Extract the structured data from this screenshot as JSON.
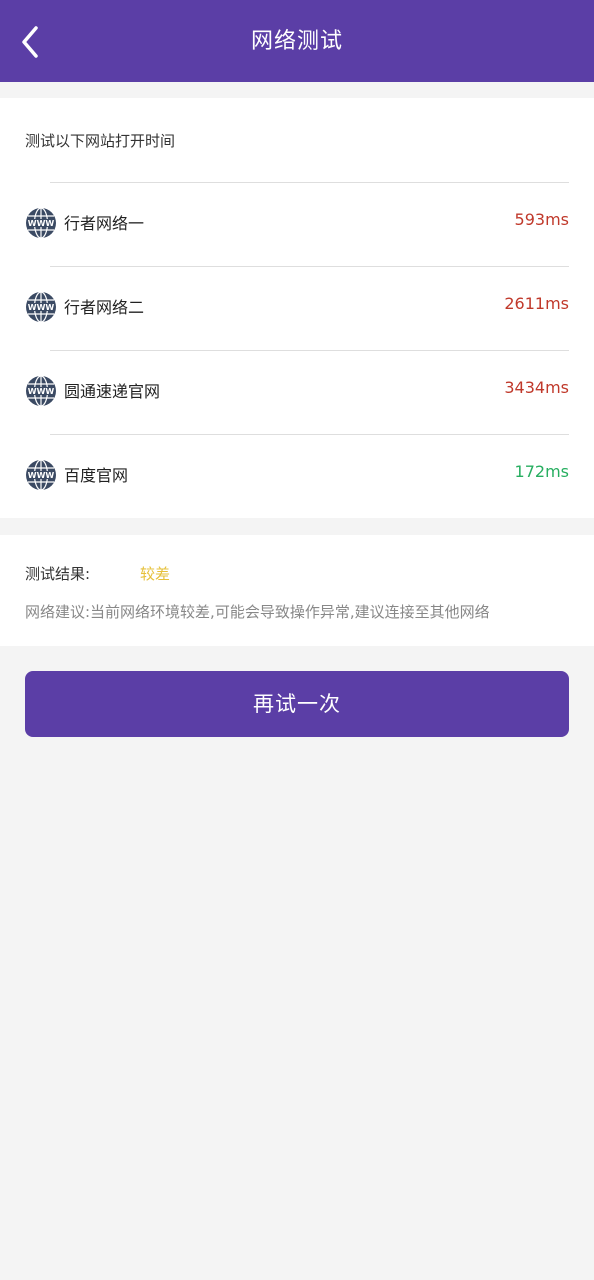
{
  "header": {
    "title": "网络测试",
    "back_icon": "chevron-left-icon"
  },
  "sites": {
    "label": "测试以下网站打开时间",
    "items": [
      {
        "name": "行者网络一",
        "time": "593ms",
        "status": "slow",
        "icon": "globe-www-icon"
      },
      {
        "name": "行者网络二",
        "time": "2611ms",
        "status": "slow",
        "icon": "globe-www-icon"
      },
      {
        "name": "圆通速递官网",
        "time": "3434ms",
        "status": "slow",
        "icon": "globe-www-icon"
      },
      {
        "name": "百度官网",
        "time": "172ms",
        "status": "fast",
        "icon": "globe-www-icon"
      }
    ]
  },
  "result": {
    "label": "测试结果:",
    "value": "较差",
    "advice": "网络建议:当前网络环境较差,可能会导致操作异常,建议连接至其他网络"
  },
  "actions": {
    "retry_label": "再试一次"
  },
  "colors": {
    "brand": "#5b3ea6",
    "slow": "#c0392b",
    "fast": "#27ae60",
    "warning": "#e6c03a"
  }
}
